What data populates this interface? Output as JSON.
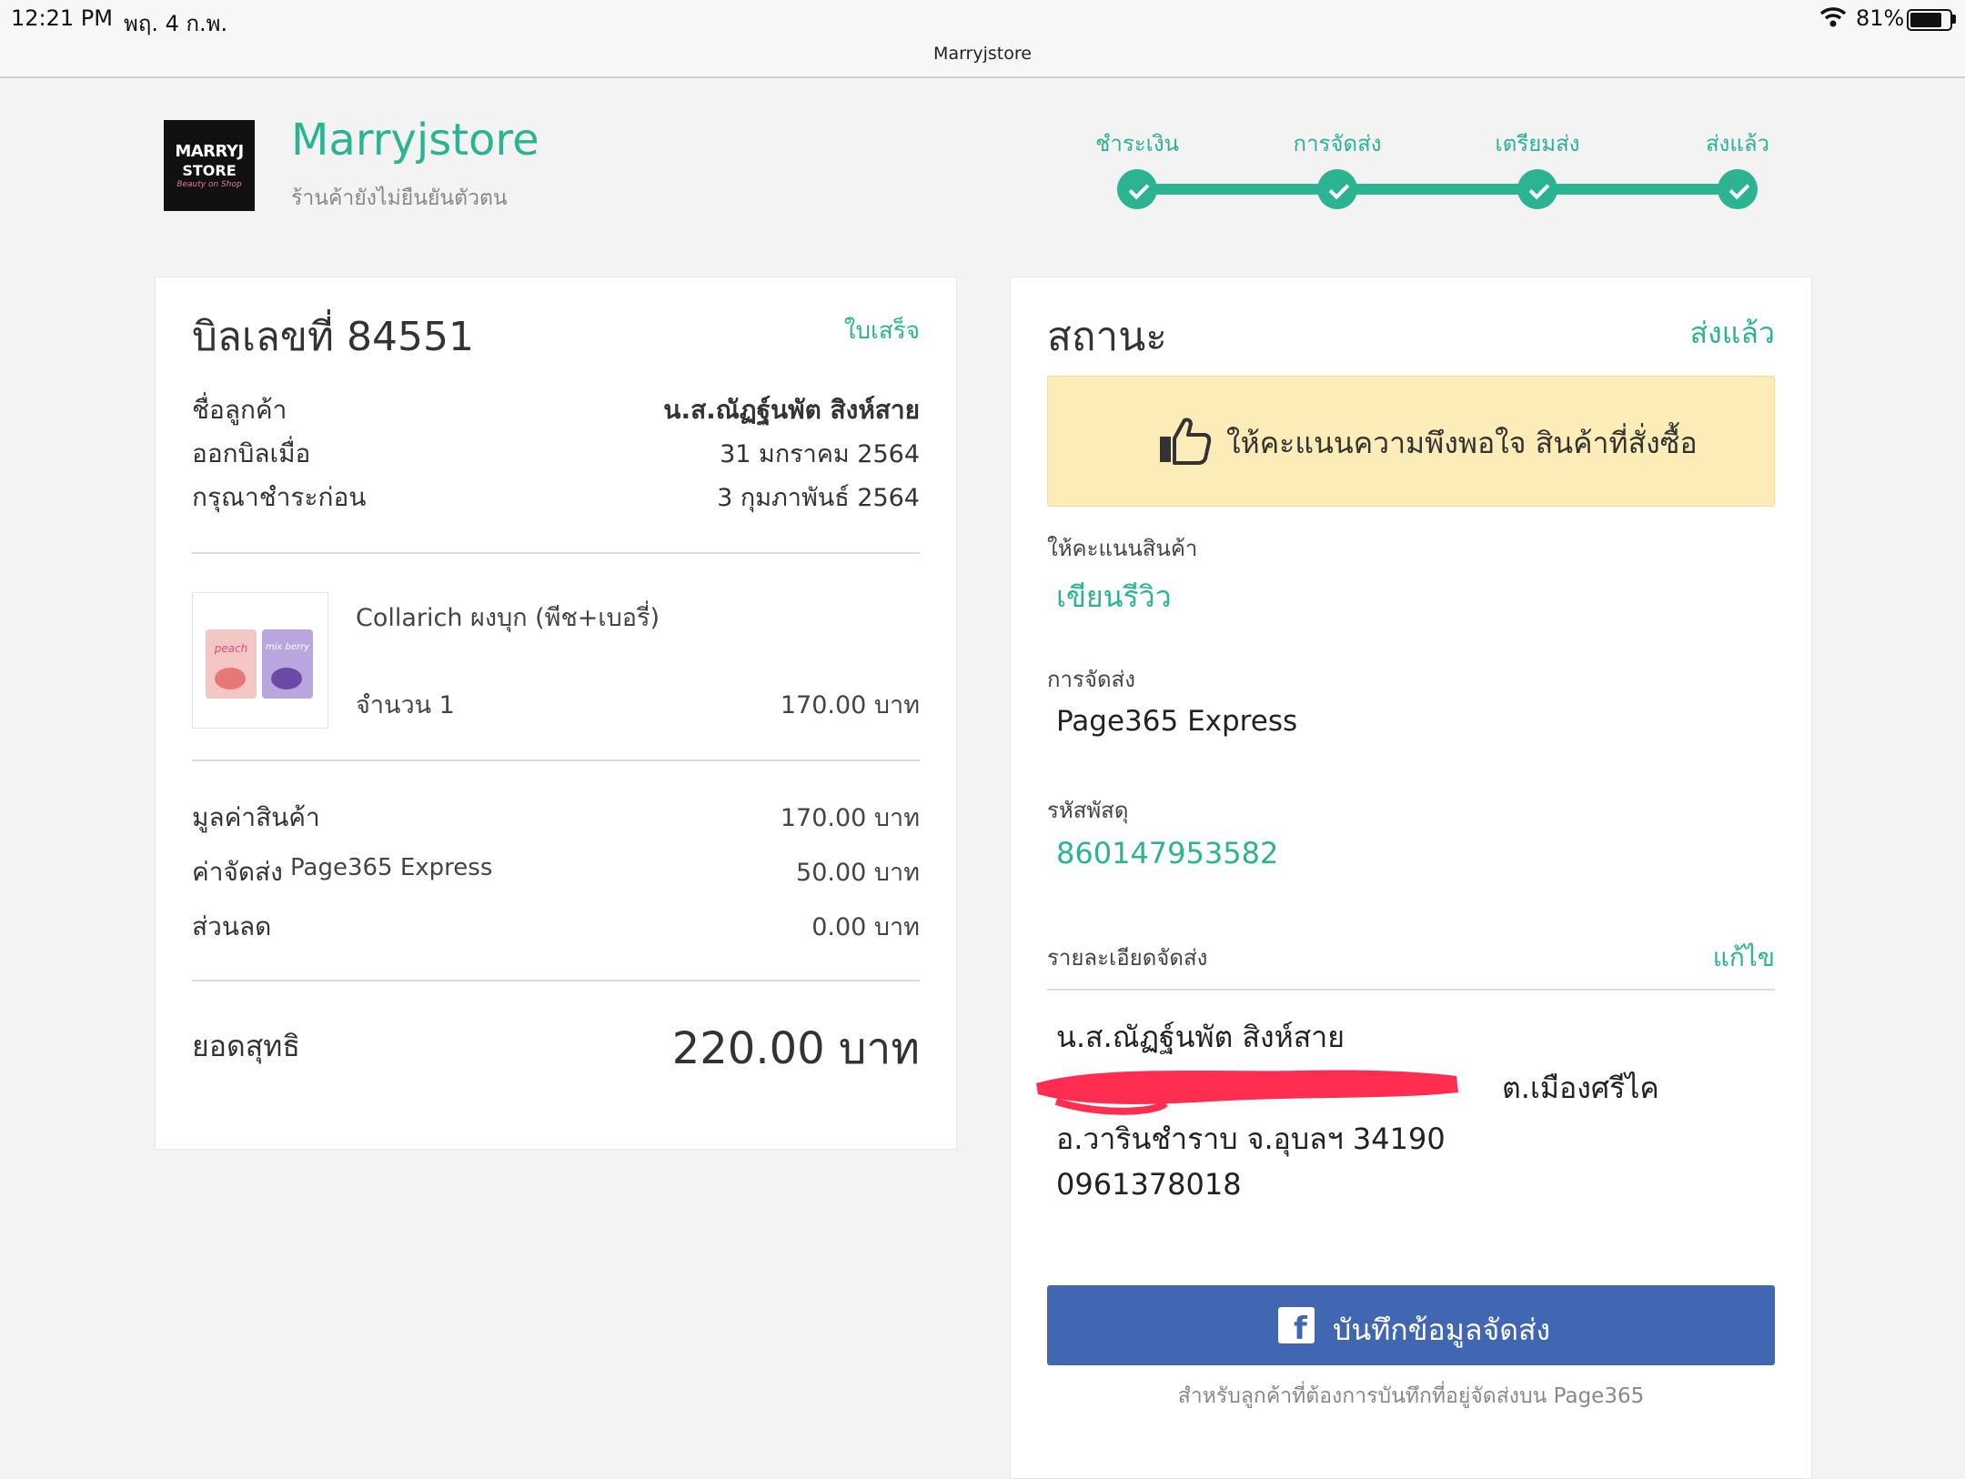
{
  "status_bar": {
    "time": "12:21 PM",
    "date": "พฤ. 4 ก.พ.",
    "host": "Marryjstore",
    "battery": "81%",
    "battery_level": 0.81,
    "wifi_icon": "wifi-icon"
  },
  "store": {
    "logo_line1": "MARRYJ",
    "logo_line2": "STORE",
    "logo_line3": "Beauty on Shop",
    "name": "Marryjstore",
    "subtitle": "ร้านค้ายังไม่ยืนยันตัวตน"
  },
  "steps": [
    {
      "label": "ชำระเงิน"
    },
    {
      "label": "การจัดส่ง"
    },
    {
      "label": "เตรียมส่ง"
    },
    {
      "label": "ส่งแล้ว"
    }
  ],
  "bill": {
    "title": "บิลเลขที่ 84551",
    "receipt_link": "ใบเสร็จ",
    "customer_label": "ชื่อลูกค้า",
    "customer_value": "น.ส.ณัฏฐ์นพัต สิงห์สาย",
    "issued_label": "ออกบิลเมื่อ",
    "issued_value": "31 มกราคม 2564",
    "due_label": "กรุณาชำระก่อน",
    "due_value": "3 กุมภาพันธ์ 2564",
    "item": {
      "name": "Collarich ผงบุก (พีช+เบอรี่)",
      "qty": "จำนวน 1",
      "price": "170.00 บาท",
      "img_left": "peach",
      "img_right": "mix berry"
    },
    "subtotal_label": "มูลค่าสินค้า",
    "subtotal_value": "170.00 บาท",
    "shipping_label": "ค่าจัดส่ง",
    "shipping_carrier": "Page365 Express",
    "shipping_value": "50.00 บาท",
    "discount_label": "ส่วนลด",
    "discount_value": "0.00 บาท",
    "total_label": "ยอดสุทธิ",
    "total_value": "220.00 บาท"
  },
  "status": {
    "title": "สถานะ",
    "state": "ส่งแล้ว",
    "rating_text": "ให้คะแนนความพึงพอใจ สินค้าที่สั่งซื้อ",
    "review_label": "ให้คะแนนสินค้า",
    "review_link": "เขียนรีวิว",
    "shipping_label": "การจัดส่ง",
    "shipping_value": "Page365 Express",
    "tracking_label": "รหัสพัสดุ",
    "tracking_value": "860147953582",
    "address_label": "รายละเอียดจัดส่ง",
    "edit_link": "แก้ไข",
    "address_name": "น.ส.ณัฏฐ์นพัต สิงห์สาย",
    "address_line1_tail": "ต.เมืองศรีไค",
    "address_line2": "อ.วารินชำราบ จ.อุบลฯ 34190",
    "phone": "0961378018",
    "fb_button": "บันทึกข้อมูลจัดส่ง",
    "fb_note": "สำหรับลูกค้าที่ต้องการบันทึกที่อยู่จัดส่งบน Page365"
  },
  "colors": {
    "accent": "#2bb392",
    "facebook": "#4267b2",
    "rating_bg": "#fcedb8",
    "redaction": "#ff2d4f"
  }
}
